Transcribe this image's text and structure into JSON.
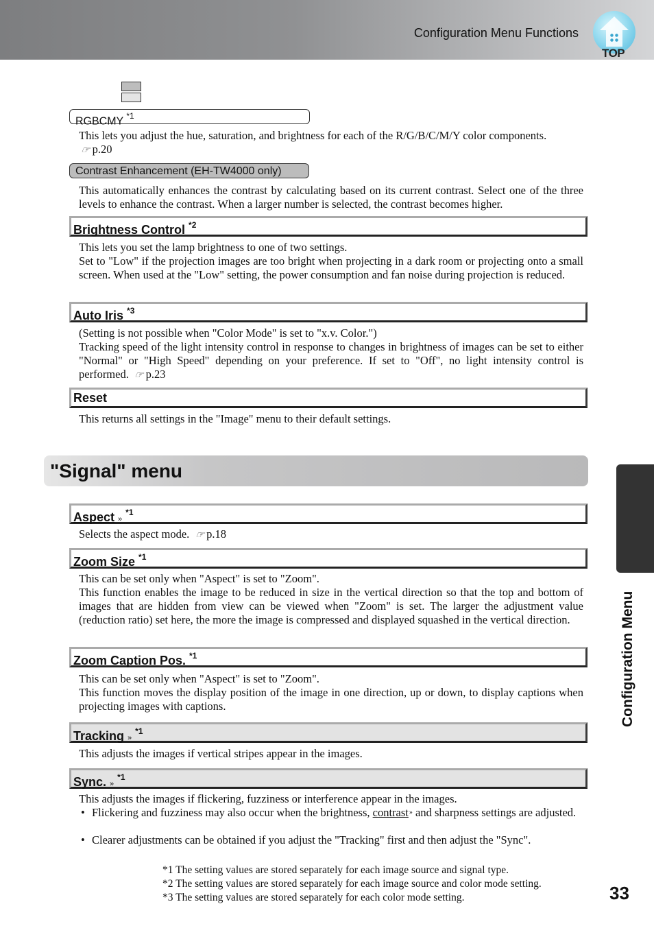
{
  "header": {
    "title": "Configuration Menu Functions",
    "top_button_label": "TOP"
  },
  "image_menu_items": [
    {
      "id": "rgbcmy",
      "title": "RGBCMY",
      "note": "*1",
      "lines": [
        "This lets you adjust the hue, saturation, and brightness for each of the R/G/B/C/M/Y color components."
      ],
      "ref": "p.20"
    },
    {
      "id": "contrast-enhancement",
      "title": "Contrast Enhancement (EH-TW4000 only)",
      "note": "",
      "lines": [
        "This automatically enhances the contrast by calculating based on its current contrast. Select one of the three levels to enhance the contrast. When a larger number is selected, the contrast becomes higher."
      ]
    },
    {
      "id": "brightness-control",
      "title": "Brightness Control",
      "note": "*2",
      "lines": [
        "This lets you set the lamp brightness to one of two settings.",
        "Set to \"Low\" if the projection images are too bright when projecting in a dark room or projecting onto a small screen.  When used at the \"Low\" setting, the power consumption and fan noise during projection is reduced."
      ]
    },
    {
      "id": "auto-iris",
      "title": "Auto Iris",
      "note": "*3",
      "lines": [
        "(Setting is not possible when \"Color Mode\" is set to \"x.v. Color.\")",
        "Tracking speed of the light intensity control in response to changes in brightness of images can be set to either \"Normal\" or \"High Speed\" depending on your preference. If set to \"Off\", no light intensity control is performed."
      ],
      "ref": "p.23"
    },
    {
      "id": "reset",
      "title": "Reset",
      "note": "",
      "lines": [
        "This returns all settings in the \"Image\" menu to their default settings."
      ]
    }
  ],
  "signal_menu": {
    "title": "\"Signal\" menu",
    "items": [
      {
        "id": "aspect",
        "title": "Aspect",
        "glossary": "»",
        "note": "*1",
        "lines": [
          "Selects the aspect mode."
        ],
        "ref": "p.18"
      },
      {
        "id": "zoom-size",
        "title": "Zoom Size",
        "note": "*1",
        "lines": [
          "This can be set only when \"Aspect\" is set to \"Zoom\".",
          "This function enables the image to be reduced in size in the vertical direction so that the top and bottom of images that are hidden from view can be viewed when \"Zoom\" is set. The larger the adjustment value (reduction ratio) set here, the more the image is compressed and displayed squashed in the vertical direction."
        ]
      },
      {
        "id": "zoom-caption-pos",
        "title": "Zoom Caption Pos.",
        "note": "*1",
        "lines": [
          "This can be set only when \"Aspect\" is set to \"Zoom\".",
          "This function moves the display position of the image in one direction, up or down, to display captions when projecting images with captions."
        ]
      },
      {
        "id": "tracking",
        "title": "Tracking",
        "glossary": "»",
        "note": "*1",
        "lines": [
          "This adjusts the images if vertical stripes appear in the images."
        ]
      },
      {
        "id": "sync",
        "title": "Sync.",
        "glossary": "»",
        "note": "*1",
        "lines": [
          "This adjusts the images if flickering, fuzziness or interference appear in the images."
        ],
        "bullets": [
          {
            "before": "Flickering and fuzziness may also occur when the brightness, ",
            "link": "contrast",
            "after": " and sharpness settings are adjusted."
          },
          {
            "before": "Clearer adjustments can be obtained if you adjust the \"Tracking\" first and then adjust the \"Sync\".",
            "link": "",
            "after": ""
          }
        ]
      }
    ]
  },
  "footnotes": [
    "*1 The setting values are stored separately for each image source and signal type.",
    "*2 The setting values are stored separately for each image source and color mode setting.",
    "*3 The setting values are stored separately for each color mode setting."
  ],
  "side_tab": {
    "label": "Configuration Menu"
  },
  "page_number": "33",
  "icons": {
    "reference": "hand-pointer-icon",
    "glossary": "double-arrow-icon",
    "bullet": "•"
  }
}
